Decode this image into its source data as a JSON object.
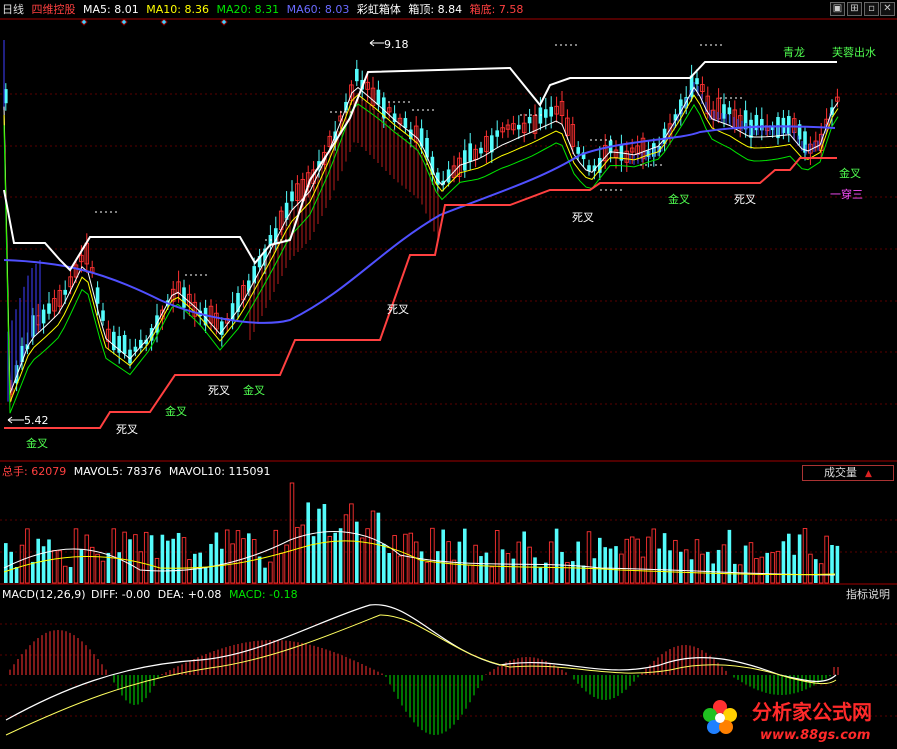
{
  "header": {
    "period": "日线",
    "indicator": "四维控股",
    "ma5_label": "MA5:",
    "ma5": "8.01",
    "ma10_label": "MA10:",
    "ma10": "8.36",
    "ma20_label": "MA20:",
    "ma20": "8.31",
    "ma60_label": "MA60:",
    "ma60": "8.03",
    "rainbow": "彩虹箱体",
    "box_top_label": "箱顶:",
    "box_top": "8.84",
    "box_bottom_label": "箱底:",
    "box_bottom": "7.58"
  },
  "price_chart": {
    "high_label": "9.18",
    "low_label": "5.42",
    "signals": {
      "golden_cross": "金叉",
      "death_cross": "死叉",
      "qinglong": "青龙",
      "furong": "芙蓉出水",
      "yichuansan": "一穿三"
    }
  },
  "volume_panel": {
    "total_label": "总手:",
    "total": "62079",
    "mavol5_label": "MAVOL5:",
    "mavol5": "78376",
    "mavol10_label": "MAVOL10:",
    "mavol10": "115091",
    "button": "成交量"
  },
  "macd_panel": {
    "title": "MACD(12,26,9)",
    "diff_label": "DIFF:",
    "diff": "-0.00",
    "dea_label": "DEA:",
    "dea": "+0.08",
    "macd_label": "MACD:",
    "macd": "-0.18",
    "button": "指标说明"
  },
  "watermark": {
    "name": "分析家公式网",
    "url": "www.88gs.com"
  },
  "colors": {
    "up": "#ff3232",
    "down": "#54fcfc",
    "ma5": "#ffffff",
    "ma10": "#ffff00",
    "ma20": "#00e600",
    "ma60": "#5050ff",
    "box_top": "#ffffff",
    "box_bottom": "#ff4040"
  }
}
